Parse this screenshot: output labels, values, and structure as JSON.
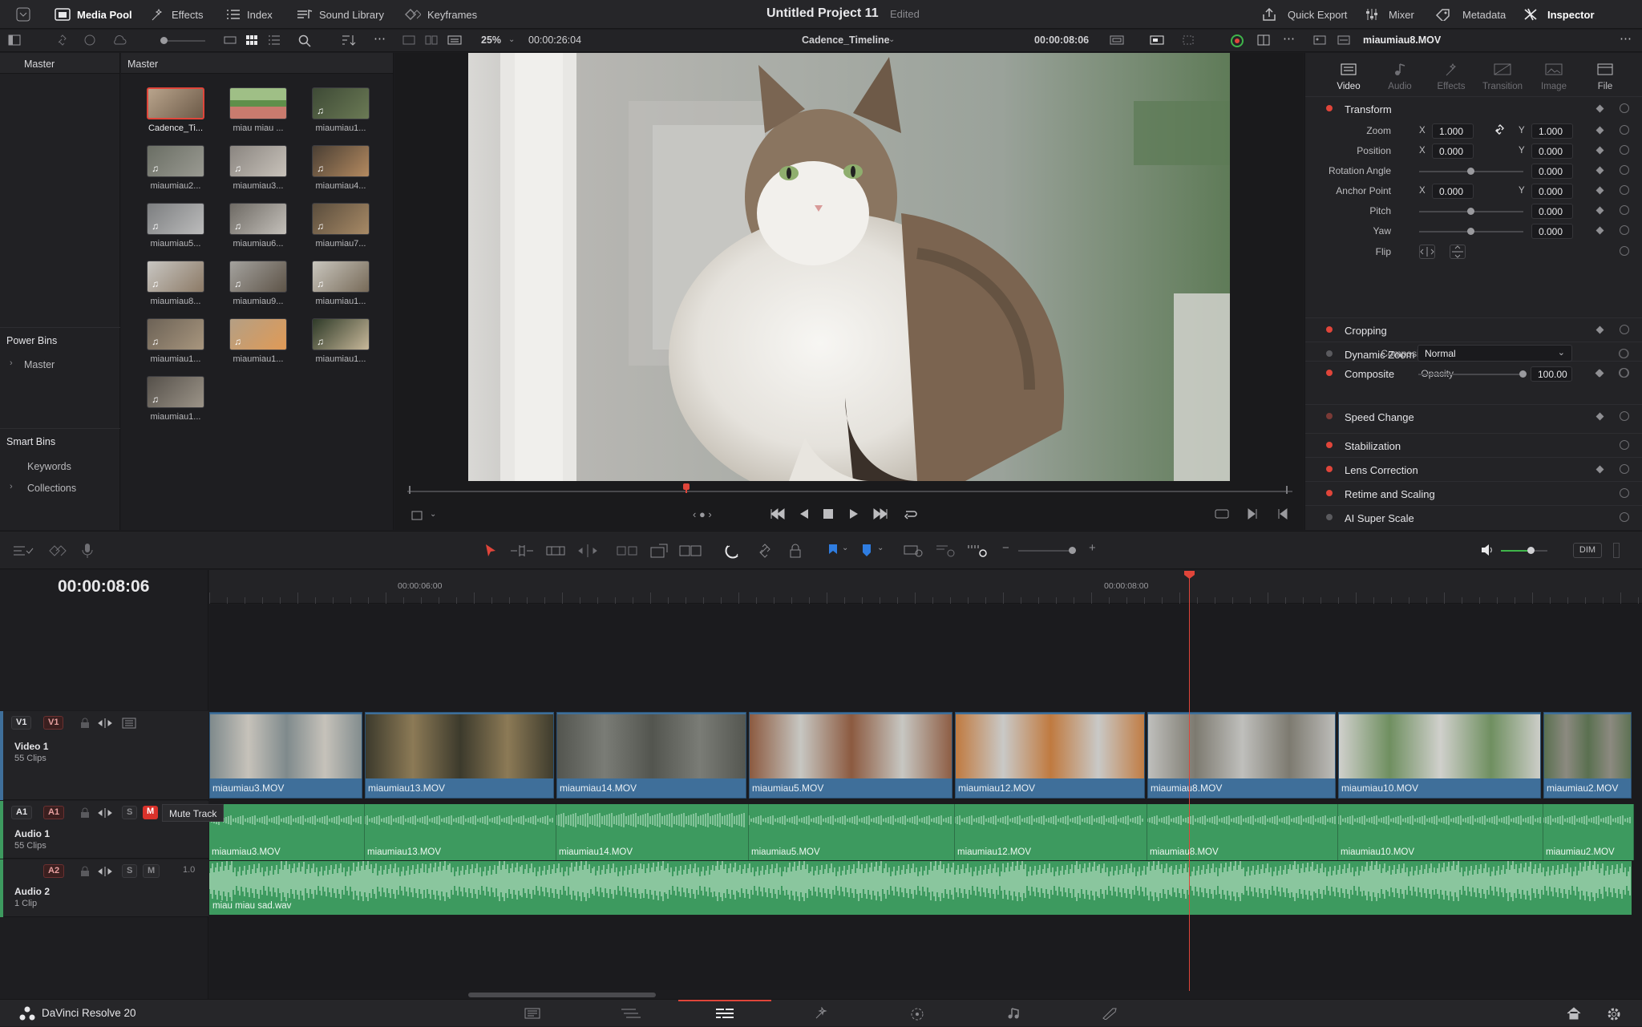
{
  "topbar": {
    "items": [
      "Media Pool",
      "Effects",
      "Index",
      "Sound Library",
      "Keyframes"
    ],
    "project_title": "Untitled Project 11",
    "project_status": "Edited",
    "right_items": [
      "Quick Export",
      "Mixer",
      "Metadata",
      "Inspector"
    ]
  },
  "viewer_bar": {
    "zoom": "25%",
    "source_timecode": "00:00:26:04",
    "timeline_name": "Cadence_Timeline",
    "record_timecode": "00:00:08:06",
    "clip_name": "miaumiau8.MOV"
  },
  "bins": {
    "header": "Master",
    "power_bins_title": "Power Bins",
    "power_bins_items": [
      "Master"
    ],
    "smart_bins_title": "Smart Bins",
    "smart_bins_items": [
      "Keywords",
      "Collections"
    ]
  },
  "media_pool": {
    "header": "Master",
    "clips": [
      "Cadence_Ti...",
      "miau miau ...",
      "miaumiau1...",
      "miaumiau2...",
      "miaumiau3...",
      "miaumiau4...",
      "miaumiau5...",
      "miaumiau6...",
      "miaumiau7...",
      "miaumiau8...",
      "miaumiau9...",
      "miaumiau1...",
      "miaumiau1...",
      "miaumiau1...",
      "miaumiau1...",
      "miaumiau1..."
    ]
  },
  "inspector": {
    "tabs": [
      "Video",
      "Audio",
      "Effects",
      "Transition",
      "Image",
      "File"
    ],
    "transform": {
      "title": "Transform",
      "zoom_label": "Zoom",
      "zoom_x": "1.000",
      "zoom_y": "1.000",
      "position_label": "Position",
      "position_x": "0.000",
      "position_y": "0.000",
      "rotation_label": "Rotation Angle",
      "rotation": "0.000",
      "anchor_label": "Anchor Point",
      "anchor_x": "0.000",
      "anchor_y": "0.000",
      "pitch_label": "Pitch",
      "pitch": "0.000",
      "yaw_label": "Yaw",
      "yaw": "0.000",
      "flip_label": "Flip",
      "x": "X",
      "y": "Y"
    },
    "sections": [
      "Cropping",
      "Dynamic Zoom",
      "Composite",
      "Speed Change",
      "Stabilization",
      "Lens Correction",
      "Retime and Scaling",
      "AI Super Scale"
    ],
    "composite_mode_label": "Composite Mode",
    "composite_mode": "Normal",
    "opacity_label": "Opacity",
    "opacity": "100.00"
  },
  "timeline": {
    "timecode": "00:00:08:06",
    "ruler_marks": [
      "00:00:06:00",
      "00:00:08:00"
    ],
    "volume_label": "DIM",
    "tooltip": "Mute Track",
    "tracks": {
      "v1": {
        "badge": "V1",
        "name": "Video 1",
        "count": "55 Clips"
      },
      "a1": {
        "badge": "A1",
        "name": "Audio 1",
        "count": "55 Clips",
        "level": "S",
        "mute": "M"
      },
      "a2": {
        "badge": "A2",
        "name": "Audio 2",
        "count": "1 Clip",
        "level": "S",
        "mute": "M",
        "gain": "1.0"
      }
    },
    "video_clips": [
      "miaumiau3.MOV",
      "miaumiau13.MOV",
      "miaumiau14.MOV",
      "miaumiau5.MOV",
      "miaumiau12.MOV",
      "miaumiau8.MOV",
      "miaumiau10.MOV",
      "miaumiau2.MOV"
    ],
    "audio_clips": [
      "miaumiau3.MOV",
      "miaumiau13.MOV",
      "miaumiau14.MOV",
      "miaumiau5.MOV",
      "miaumiau12.MOV",
      "miaumiau8.MOV",
      "miaumiau10.MOV",
      "miaumiau2.MOV"
    ],
    "audio2_clip": "miau miau sad.wav"
  },
  "app": {
    "name": "DaVinci Resolve 20"
  }
}
